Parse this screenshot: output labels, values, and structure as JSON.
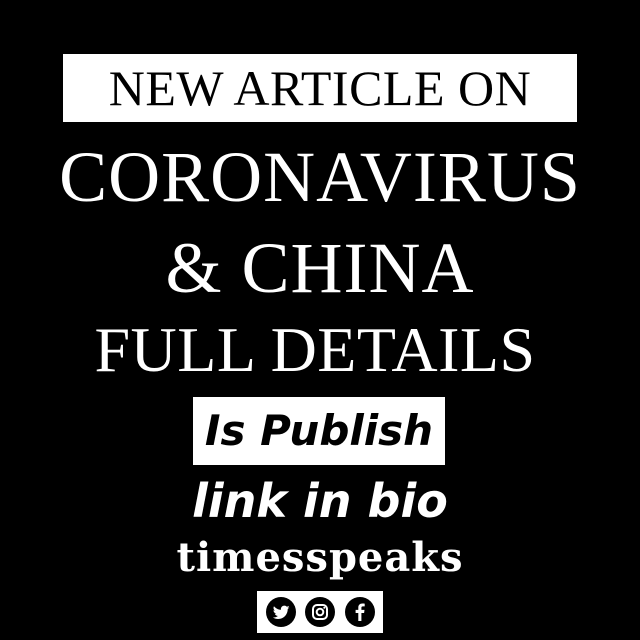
{
  "post": {
    "headline": "NEW ARTICLE ON",
    "line1": "CORONAVIRUS",
    "line2": "& CHINA",
    "line3": "FULL DETAILS",
    "publish_label": "Is Publish",
    "link_label": "link in bio",
    "brand": "timesspeaks"
  },
  "colors": {
    "background": "#000000",
    "text": "#ffffff",
    "box": "#ffffff",
    "box_text": "#000000"
  },
  "social": {
    "icons": [
      "twitter-icon",
      "instagram-icon",
      "facebook-icon"
    ]
  }
}
